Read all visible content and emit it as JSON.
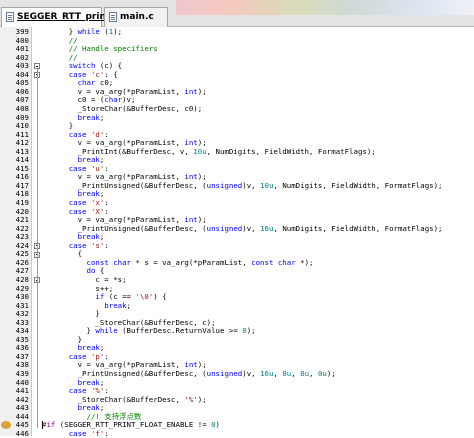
{
  "tabs": [
    {
      "label": "SEGGER_RTT_printf.c",
      "active": true
    },
    {
      "label": "main.c",
      "active": false
    }
  ],
  "colors": {
    "keyword": "#0000ff",
    "number": "#008080",
    "comment": "#008000",
    "preprocessor": "#800080",
    "string": "#a31515"
  },
  "editor": {
    "lines": [
      {
        "num": "399",
        "segs": [
          [
            "      } ",
            ""
          ],
          [
            "while",
            "kw"
          ],
          [
            " (",
            ""
          ],
          [
            "1",
            "num"
          ],
          [
            ");",
            ""
          ]
        ]
      },
      {
        "num": "400",
        "segs": [
          [
            "      ",
            ""
          ],
          [
            "//",
            "cm"
          ]
        ]
      },
      {
        "num": "401",
        "segs": [
          [
            "      ",
            ""
          ],
          [
            "// Handle specifiers",
            "cm"
          ]
        ]
      },
      {
        "num": "402",
        "segs": [
          [
            "      ",
            ""
          ],
          [
            "//",
            "cm"
          ]
        ]
      },
      {
        "num": "403",
        "segs": [
          [
            "      ",
            ""
          ],
          [
            "switch",
            "kw"
          ],
          [
            " (c) {",
            ""
          ]
        ]
      },
      {
        "num": "404",
        "segs": [
          [
            "      ",
            ""
          ],
          [
            "case",
            "kw"
          ],
          [
            " ",
            ""
          ],
          [
            "'c'",
            "str"
          ],
          [
            ": {",
            ""
          ]
        ]
      },
      {
        "num": "405",
        "segs": [
          [
            "        ",
            ""
          ],
          [
            "char",
            "kw"
          ],
          [
            " c0;",
            ""
          ]
        ]
      },
      {
        "num": "406",
        "segs": [
          [
            "        v = va_arg(*pParamList, ",
            ""
          ],
          [
            "int",
            "kw"
          ],
          [
            ");",
            ""
          ]
        ]
      },
      {
        "num": "407",
        "segs": [
          [
            "        c0 = (",
            ""
          ],
          [
            "char",
            "kw"
          ],
          [
            ")v;",
            ""
          ]
        ]
      },
      {
        "num": "408",
        "segs": [
          [
            "        _StoreChar(&BufferDesc, c0);",
            ""
          ]
        ]
      },
      {
        "num": "409",
        "segs": [
          [
            "        ",
            ""
          ],
          [
            "break",
            "kw"
          ],
          [
            ";",
            ""
          ]
        ]
      },
      {
        "num": "410",
        "segs": [
          [
            "      }",
            ""
          ]
        ]
      },
      {
        "num": "411",
        "segs": [
          [
            "      ",
            ""
          ],
          [
            "case",
            "kw"
          ],
          [
            " ",
            ""
          ],
          [
            "'d'",
            "str"
          ],
          [
            ":",
            ""
          ]
        ]
      },
      {
        "num": "412",
        "segs": [
          [
            "        v = va_arg(*pParamList, ",
            ""
          ],
          [
            "int",
            "kw"
          ],
          [
            ");",
            ""
          ]
        ]
      },
      {
        "num": "413",
        "segs": [
          [
            "        _PrintInt(&BufferDesc, v, ",
            ""
          ],
          [
            "10u",
            "num"
          ],
          [
            ", NumDigits, FieldWidth, FormatFlags);",
            ""
          ]
        ]
      },
      {
        "num": "414",
        "segs": [
          [
            "        ",
            ""
          ],
          [
            "break",
            "kw"
          ],
          [
            ";",
            ""
          ]
        ]
      },
      {
        "num": "415",
        "segs": [
          [
            "      ",
            ""
          ],
          [
            "case",
            "kw"
          ],
          [
            " ",
            ""
          ],
          [
            "'u'",
            "str"
          ],
          [
            ":",
            ""
          ]
        ]
      },
      {
        "num": "416",
        "segs": [
          [
            "        v = va_arg(*pParamList, ",
            ""
          ],
          [
            "int",
            "kw"
          ],
          [
            ");",
            ""
          ]
        ]
      },
      {
        "num": "417",
        "segs": [
          [
            "        _PrintUnsigned(&BufferDesc, (",
            ""
          ],
          [
            "unsigned",
            "kw"
          ],
          [
            ")v, ",
            ""
          ],
          [
            "10u",
            "num"
          ],
          [
            ", NumDigits, FieldWidth, FormatFlags);",
            ""
          ]
        ]
      },
      {
        "num": "418",
        "segs": [
          [
            "        ",
            ""
          ],
          [
            "break",
            "kw"
          ],
          [
            ";",
            ""
          ]
        ]
      },
      {
        "num": "419",
        "segs": [
          [
            "      ",
            ""
          ],
          [
            "case",
            "kw"
          ],
          [
            " ",
            ""
          ],
          [
            "'x'",
            "str"
          ],
          [
            ":",
            ""
          ]
        ]
      },
      {
        "num": "420",
        "segs": [
          [
            "      ",
            ""
          ],
          [
            "case",
            "kw"
          ],
          [
            " ",
            ""
          ],
          [
            "'X'",
            "str"
          ],
          [
            ":",
            ""
          ]
        ]
      },
      {
        "num": "421",
        "segs": [
          [
            "        v = va_arg(*pParamList, ",
            ""
          ],
          [
            "int",
            "kw"
          ],
          [
            ");",
            ""
          ]
        ]
      },
      {
        "num": "422",
        "segs": [
          [
            "        _PrintUnsigned(&BufferDesc, (",
            ""
          ],
          [
            "unsigned",
            "kw"
          ],
          [
            ")v, ",
            ""
          ],
          [
            "16u",
            "num"
          ],
          [
            ", NumDigits, FieldWidth, FormatFlags);",
            ""
          ]
        ]
      },
      {
        "num": "423",
        "segs": [
          [
            "        ",
            ""
          ],
          [
            "break",
            "kw"
          ],
          [
            ";",
            ""
          ]
        ]
      },
      {
        "num": "424",
        "segs": [
          [
            "      ",
            ""
          ],
          [
            "case",
            "kw"
          ],
          [
            " ",
            ""
          ],
          [
            "'s'",
            "str"
          ],
          [
            ":",
            ""
          ]
        ]
      },
      {
        "num": "425",
        "segs": [
          [
            "        {",
            ""
          ]
        ]
      },
      {
        "num": "426",
        "segs": [
          [
            "          ",
            ""
          ],
          [
            "const",
            "kw"
          ],
          [
            " ",
            ""
          ],
          [
            "char",
            "kw"
          ],
          [
            " * s = va_arg(*pParamList, ",
            ""
          ],
          [
            "const",
            "kw"
          ],
          [
            " ",
            ""
          ],
          [
            "char",
            "kw"
          ],
          [
            " *);",
            ""
          ]
        ]
      },
      {
        "num": "427",
        "segs": [
          [
            "          ",
            ""
          ],
          [
            "do",
            "kw"
          ],
          [
            " {",
            ""
          ]
        ]
      },
      {
        "num": "428",
        "segs": [
          [
            "            c = *s;",
            ""
          ]
        ]
      },
      {
        "num": "429",
        "segs": [
          [
            "            s++;",
            ""
          ]
        ]
      },
      {
        "num": "430",
        "segs": [
          [
            "            ",
            ""
          ],
          [
            "if",
            "kw"
          ],
          [
            " (c == ",
            ""
          ],
          [
            "'\\0'",
            "str"
          ],
          [
            ") {",
            ""
          ]
        ]
      },
      {
        "num": "431",
        "segs": [
          [
            "              ",
            ""
          ],
          [
            "break",
            "kw"
          ],
          [
            ";",
            ""
          ]
        ]
      },
      {
        "num": "432",
        "segs": [
          [
            "            }",
            ""
          ]
        ]
      },
      {
        "num": "433",
        "segs": [
          [
            "            _StoreChar(&BufferDesc, c);",
            ""
          ]
        ]
      },
      {
        "num": "434",
        "segs": [
          [
            "          } ",
            ""
          ],
          [
            "while",
            "kw"
          ],
          [
            " (BufferDesc.ReturnValue >= ",
            ""
          ],
          [
            "0",
            "num"
          ],
          [
            ");",
            ""
          ]
        ]
      },
      {
        "num": "435",
        "segs": [
          [
            "        }",
            ""
          ]
        ]
      },
      {
        "num": "436",
        "segs": [
          [
            "        ",
            ""
          ],
          [
            "break",
            "kw"
          ],
          [
            ";",
            ""
          ]
        ]
      },
      {
        "num": "437",
        "segs": [
          [
            "      ",
            ""
          ],
          [
            "case",
            "kw"
          ],
          [
            " ",
            ""
          ],
          [
            "'p'",
            "str"
          ],
          [
            ":",
            ""
          ]
        ]
      },
      {
        "num": "438",
        "segs": [
          [
            "        v = va_arg(*pParamList, ",
            ""
          ],
          [
            "int",
            "kw"
          ],
          [
            ");",
            ""
          ]
        ]
      },
      {
        "num": "439",
        "segs": [
          [
            "        _PrintUnsigned(&BufferDesc, (",
            ""
          ],
          [
            "unsigned",
            "kw"
          ],
          [
            ")v, ",
            ""
          ],
          [
            "16u",
            "num"
          ],
          [
            ", ",
            ""
          ],
          [
            "8u",
            "num"
          ],
          [
            ", ",
            ""
          ],
          [
            "8u",
            "num"
          ],
          [
            ", ",
            ""
          ],
          [
            "0u",
            "num"
          ],
          [
            ");",
            ""
          ]
        ]
      },
      {
        "num": "440",
        "segs": [
          [
            "        ",
            ""
          ],
          [
            "break",
            "kw"
          ],
          [
            ";",
            ""
          ]
        ]
      },
      {
        "num": "441",
        "segs": [
          [
            "      ",
            ""
          ],
          [
            "case",
            "kw"
          ],
          [
            " ",
            ""
          ],
          [
            "'%'",
            "str"
          ],
          [
            ":",
            ""
          ]
        ]
      },
      {
        "num": "442",
        "segs": [
          [
            "        _StoreChar(&BufferDesc, ",
            ""
          ],
          [
            "'%'",
            "str"
          ],
          [
            ");",
            ""
          ]
        ]
      },
      {
        "num": "443",
        "segs": [
          [
            "        ",
            ""
          ],
          [
            "break",
            "kw"
          ],
          [
            ";",
            ""
          ]
        ]
      },
      {
        "num": "444",
        "segs": [
          [
            "          ",
            ""
          ],
          [
            "//! 支持浮点数",
            "cm"
          ]
        ]
      },
      {
        "num": "445",
        "segs": [
          [
            "#if",
            "pp"
          ],
          [
            " (SEGGER_RTT_PRINT_FLOAT_ENABLE != ",
            ""
          ],
          [
            "0",
            "num"
          ],
          [
            ")",
            ""
          ]
        ]
      },
      {
        "num": "446",
        "segs": [
          [
            "      ",
            ""
          ],
          [
            "case",
            "kw"
          ],
          [
            " ",
            ""
          ],
          [
            "'f'",
            "str"
          ],
          [
            ":",
            ""
          ]
        ]
      }
    ]
  }
}
